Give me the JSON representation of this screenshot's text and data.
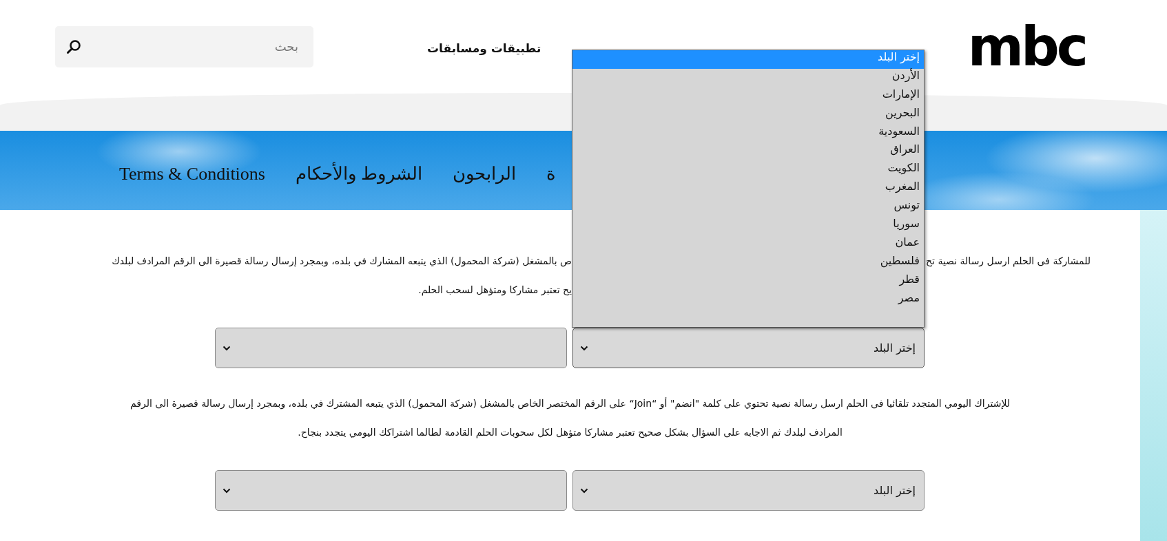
{
  "header": {
    "logo": "mbc",
    "search": {
      "placeholder": "بحث"
    },
    "nav_items": [
      {
        "label": "تطبيقات ومسابقات"
      }
    ]
  },
  "subnav": {
    "items": [
      {
        "label": "ة"
      },
      {
        "label": "الرابحون"
      },
      {
        "label": "الشروط والأحكام"
      },
      {
        "label": "Terms & Conditions"
      }
    ]
  },
  "sections": [
    {
      "lines": [
        {
          "kind": "split",
          "start": "للمشاركة فى الحلم ارسل رسالة نصية تح",
          "end": "ص بالمشغل (شركة المحمول) الذي يتبعه المشارك في بلده، وبمجرد إرسال رسالة قصيرة الى الرقم المرادف لبلدك"
        },
        {
          "kind": "split",
          "end": "يح تعتبر مشاركا ومتؤهل لسحب الحلم."
        }
      ],
      "country_select": {
        "value": "إختر البلد",
        "expanded": true,
        "options": [
          {
            "label": "إختر البلد",
            "selected": true
          },
          {
            "label": "الأردن",
            "selected": false
          },
          {
            "label": "الإمارات",
            "selected": false
          },
          {
            "label": "البحرين",
            "selected": false
          },
          {
            "label": "السعودية",
            "selected": false
          },
          {
            "label": "العراق",
            "selected": false
          },
          {
            "label": "الكويت",
            "selected": false
          },
          {
            "label": "المغرب",
            "selected": false
          },
          {
            "label": "تونس",
            "selected": false
          },
          {
            "label": "سوريا",
            "selected": false
          },
          {
            "label": "عمان",
            "selected": false
          },
          {
            "label": "فلسطين",
            "selected": false
          },
          {
            "label": "قطر",
            "selected": false
          },
          {
            "label": "مصر",
            "selected": false
          }
        ]
      },
      "operator_select": {
        "expanded": false
      }
    },
    {
      "lines": [
        {
          "kind": "full",
          "text": "للإشتراك اليومي المتجدد تلقائيا فى الحلم ارسل رسالة نصية تحتوي على كلمة \"انضم\" أو “Join“ على الرقم المختصر الخاص بالمشغل (شركة المحمول) الذي يتبعه المشترك في بلده، وبمجرد إرسال رسالة قصيرة الى الرقم"
        },
        {
          "kind": "full",
          "text": "المرادف لبلدك ثم الاجابه على السؤال بشكل صحيح تعتبر مشاركا متؤهل لكل سحوبات الحلم القادمة لطالما اشتراكك اليومي يتجدد بنجاح."
        }
      ],
      "country_select": {
        "value": "إختر البلد",
        "expanded": false
      },
      "operator_select": {
        "expanded": false
      }
    }
  ]
}
